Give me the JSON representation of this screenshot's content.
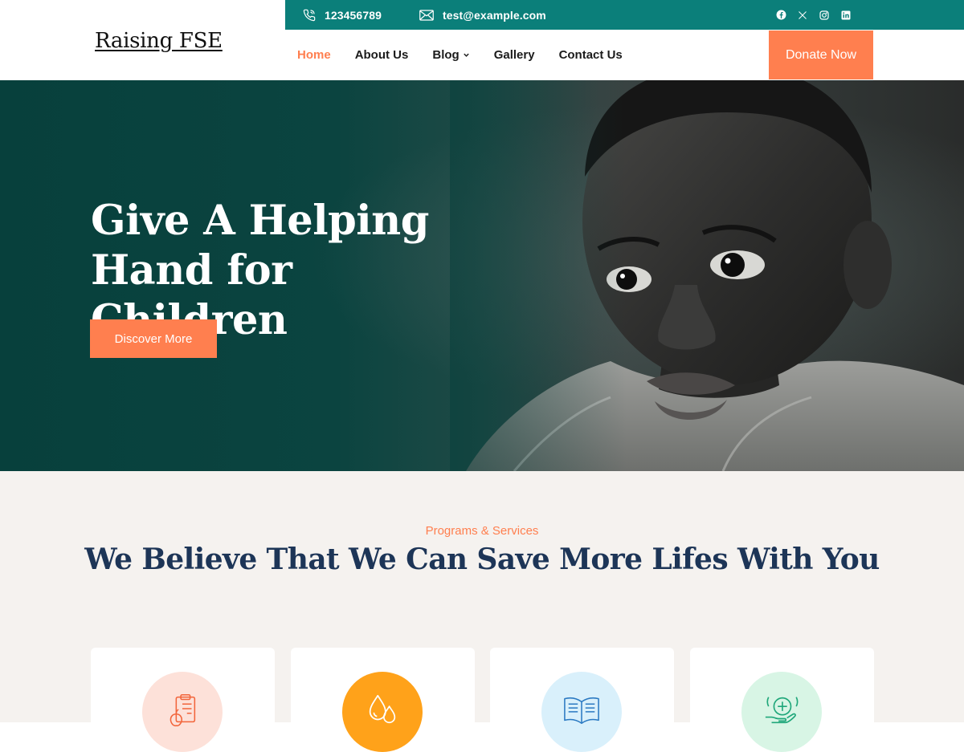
{
  "header": {
    "phone": "123456789",
    "email": "test@example.com",
    "logo": "Raising FSE",
    "social_icons": [
      "facebook-icon",
      "x-icon",
      "instagram-icon",
      "linkedin-icon"
    ],
    "nav": [
      {
        "label": "Home",
        "active": true
      },
      {
        "label": "About Us"
      },
      {
        "label": "Blog",
        "has_dropdown": true
      },
      {
        "label": "Gallery"
      },
      {
        "label": "Contact Us"
      }
    ],
    "donate_label": "Donate Now"
  },
  "hero": {
    "title": "Give A Helping Hand for Children",
    "button_label": "Discover More"
  },
  "services": {
    "eyebrow": "Programs & Services",
    "title": "We Believe That We Can Save More Lifes With You",
    "cards": [
      {
        "icon": "clipboard-apple-icon",
        "circle_color": "#fde1d9"
      },
      {
        "icon": "water-drops-icon",
        "circle_color": "#ffa21a"
      },
      {
        "icon": "open-book-icon",
        "circle_color": "#d9f0fb"
      },
      {
        "icon": "medical-care-hand-icon",
        "circle_color": "#d8f5e5"
      }
    ]
  },
  "colors": {
    "topbar": "#0b7f7a",
    "accent": "#ff7f4f",
    "heading": "#1d3557",
    "section_bg": "#f5f2ef"
  }
}
